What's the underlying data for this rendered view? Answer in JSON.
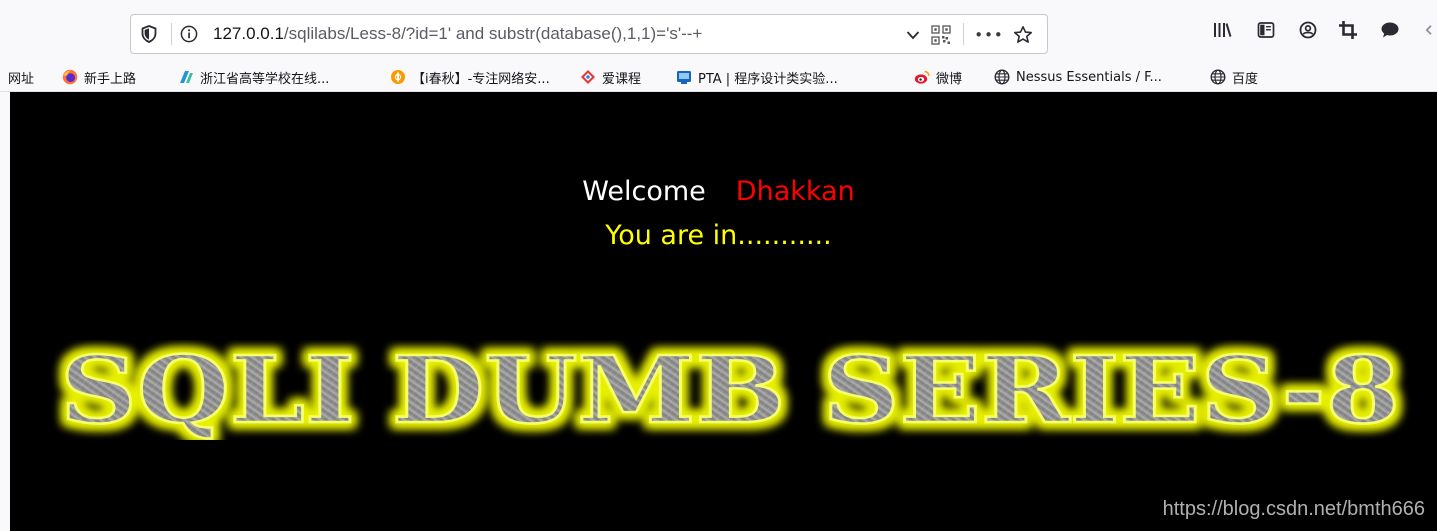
{
  "browser": {
    "url": {
      "host": "127.0.0.1",
      "path": "/sqlilabs/Less-8/?id=1' and substr(database(),1,1)='s'--+"
    },
    "icons": {
      "shield": "shield-icon",
      "info": "info-icon",
      "dropdown": "chevron-down-icon",
      "qr": "qr-code-icon",
      "more": "more-icon",
      "star": "bookmark-star-icon",
      "library": "library-icon",
      "sidebar": "sidebar-icon",
      "account": "account-icon",
      "screenshot": "crop-icon",
      "chat": "chat-icon"
    },
    "more_label": "•••",
    "bookmarks": [
      {
        "label": "网址",
        "icon": "none"
      },
      {
        "label": "新手上路",
        "icon": "firefox-icon"
      },
      {
        "label": "浙江省高等学校在线...",
        "icon": "zj-icon"
      },
      {
        "label": "【i春秋】-专注网络安...",
        "icon": "ichunqiu-icon"
      },
      {
        "label": "爱课程",
        "icon": "icourse-icon"
      },
      {
        "label": "PTA | 程序设计类实验...",
        "icon": "pta-icon"
      },
      {
        "label": "微博",
        "icon": "weibo-icon"
      },
      {
        "label": "Nessus Essentials / F...",
        "icon": "globe-icon"
      },
      {
        "label": "百度",
        "icon": "globe-icon"
      }
    ]
  },
  "page": {
    "welcome_text": "Welcome",
    "welcome_name": "Dhakkan",
    "status_text": "You are in...........",
    "banner_text": "SQLI DUMB SERIES-8",
    "colors": {
      "background": "#000000",
      "welcome": "#ffffff",
      "name": "#ff0000",
      "status": "#ffff00",
      "banner_glow": "#e8f000",
      "banner_fill": "#8a8a8a"
    }
  },
  "watermark": "https://blog.csdn.net/bmth666"
}
